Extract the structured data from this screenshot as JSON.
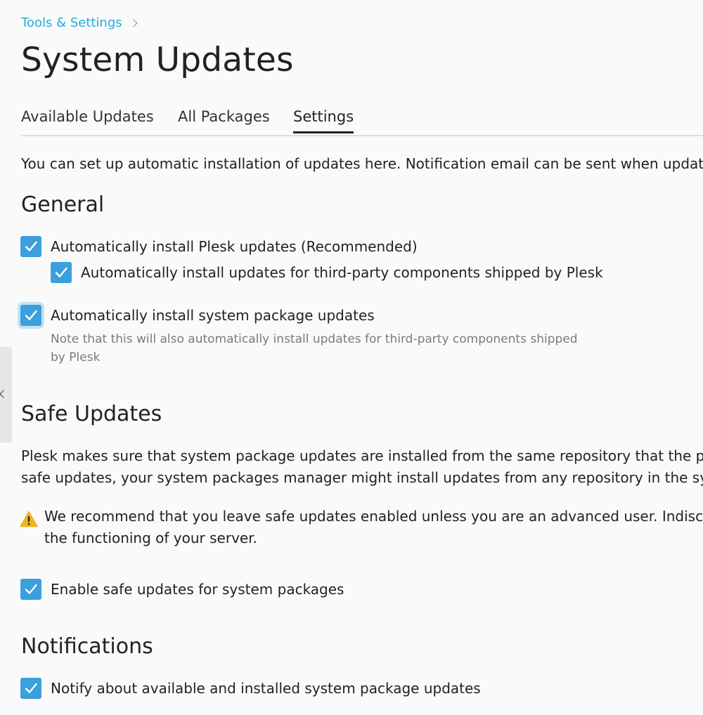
{
  "breadcrumb": {
    "label": "Tools & Settings"
  },
  "page": {
    "title": "System Updates"
  },
  "tabs": [
    {
      "label": "Available Updates",
      "active": false
    },
    {
      "label": "All Packages",
      "active": false
    },
    {
      "label": "Settings",
      "active": true
    }
  ],
  "intro": "You can set up automatic installation of updates here. Notification email can be sent when updates",
  "general": {
    "title": "General",
    "auto_plesk": {
      "label": "Automatically install Plesk updates (Recommended)",
      "checked": true
    },
    "auto_third_party": {
      "label": "Automatically install updates for third-party components shipped by Plesk",
      "checked": true
    },
    "auto_system": {
      "label": "Automatically install system package updates",
      "checked": true
    },
    "auto_system_hint": "Note that this will also automatically install updates for third-party components shipped by Plesk"
  },
  "safe_updates": {
    "title": "Safe Updates",
    "line1": "Plesk makes sure that system package updates are installed from the same repository that the pa",
    "line2": "safe updates, your system packages manager might install updates from any repository in the sys",
    "warning_line1": "We recommend that you leave safe updates enabled unless you are an advanced user. Indiscr",
    "warning_line2": "the functioning of your server.",
    "enable": {
      "label": "Enable safe updates for system packages",
      "checked": true
    }
  },
  "notifications": {
    "title": "Notifications",
    "notify": {
      "label": "Notify about available and installed system package updates",
      "checked": true
    }
  },
  "icons": {
    "checkbox_check": "check-icon",
    "warning": "warning-icon",
    "sidebar_toggle": "chevron-left-icon",
    "breadcrumb_separator": "chevron-right-icon"
  },
  "colors": {
    "accent": "#3b9fdc",
    "link": "#28aade",
    "warning": "#f0b323"
  }
}
